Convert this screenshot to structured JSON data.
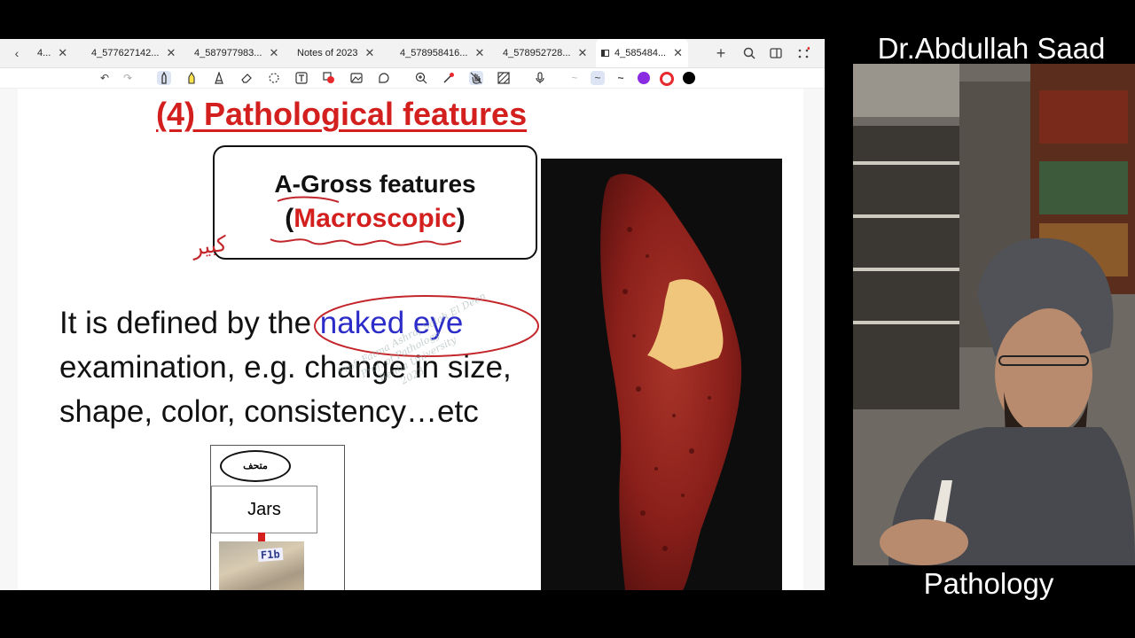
{
  "browser": {
    "tabs": [
      {
        "label": "4..."
      },
      {
        "label": "4_577627142..."
      },
      {
        "label": "4_587977983..."
      },
      {
        "label": "Notes of 2023"
      },
      {
        "label": "4_578958416..."
      },
      {
        "label": "4_578952728..."
      },
      {
        "label": "4_585484..."
      }
    ],
    "active_tab_index": 6,
    "icons": [
      "back-icon",
      "close-icon",
      "new-tab-icon",
      "search-icon",
      "tabs-grid-icon",
      "more-icon"
    ]
  },
  "toolbar": {
    "tools": [
      "undo-icon",
      "redo-icon",
      "pen-icon",
      "highlighter-icon",
      "pencil-icon",
      "eraser-icon",
      "lasso-icon",
      "text-icon",
      "shapes-icon",
      "image-icon",
      "sticker-icon",
      "zoom-icon",
      "laser-pointer-icon",
      "hand-icon",
      "hatch-icon",
      "microphone-icon",
      "stroke-thin-icon",
      "stroke-medium-icon",
      "stroke-thick-icon"
    ],
    "colors": [
      "#8a2be2",
      "#e8292d",
      "#000000"
    ]
  },
  "slide": {
    "title": "(4) Pathological features",
    "gross_box": {
      "line1": "A-Gross features",
      "line2_open": "(",
      "line2_red": "Macroscopic",
      "line2_close": ")"
    },
    "body": {
      "part1": "It is defined by the ",
      "highlight": "naked eye",
      "part2": "examination, e.g. change in size, shape, color, consistency…etc"
    },
    "watermark": [
      "Prof. Fatma Ashraf Salah El Deen",
      "Prof. of Pathology",
      "Benha University",
      "2023"
    ],
    "handwriting": "كبير",
    "jars": {
      "label_top": "متحف",
      "label_box": "Jars",
      "photo_label": "F1b"
    }
  },
  "presenter": {
    "name": "Dr.Abdullah Saad",
    "subject": "Pathology"
  },
  "colors": {
    "title_red": "#d41f1f",
    "highlight_blue": "#2c2cc9",
    "ink_red": "#c3262b"
  }
}
